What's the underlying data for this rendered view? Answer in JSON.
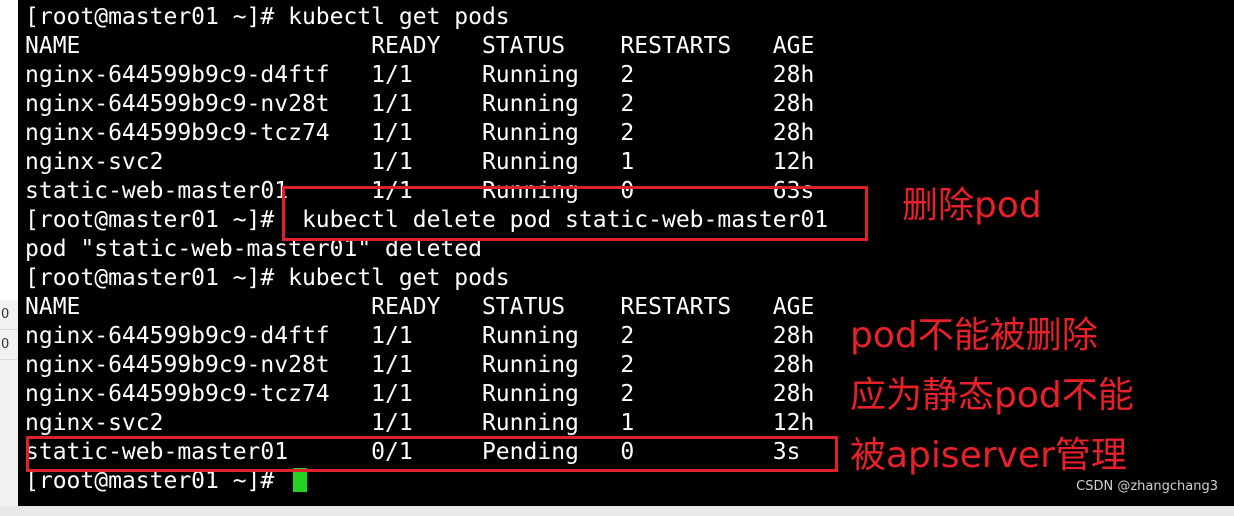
{
  "terminal": {
    "lines": [
      "[root@master01 ~]# kubectl get pods",
      "NAME                     READY   STATUS    RESTARTS   AGE",
      "nginx-644599b9c9-d4ftf   1/1     Running   2          28h",
      "nginx-644599b9c9-nv28t   1/1     Running   2          28h",
      "nginx-644599b9c9-tcz74   1/1     Running   2          28h",
      "nginx-svc2               1/1     Running   1          12h",
      "static-web-master01      1/1     Running   0          63s",
      "[root@master01 ~]#  kubectl delete pod static-web-master01",
      "pod \"static-web-master01\" deleted",
      "[root@master01 ~]# kubectl get pods",
      "NAME                     READY   STATUS    RESTARTS   AGE",
      "nginx-644599b9c9-d4ftf   1/1     Running   2          28h",
      "nginx-644599b9c9-nv28t   1/1     Running   2          28h",
      "nginx-644599b9c9-tcz74   1/1     Running   2          28h",
      "nginx-svc2               1/1     Running   1          12h",
      "static-web-master01      0/1     Pending   0          3s",
      "[root@master01 ~]# "
    ]
  },
  "annotations": {
    "delete_pod": "删除pod",
    "cannot_delete": "pod不能被删除",
    "because_static": "应为静态pod不能",
    "managed_by": "被apiserver管理"
  },
  "side_panel": {
    "cells": [
      "0",
      "0"
    ]
  },
  "watermark": "CSDN @zhangchang3",
  "colors": {
    "highlight": "#e0202a",
    "cursor": "#22d322",
    "background": "#000000",
    "text": "#ffffff"
  }
}
